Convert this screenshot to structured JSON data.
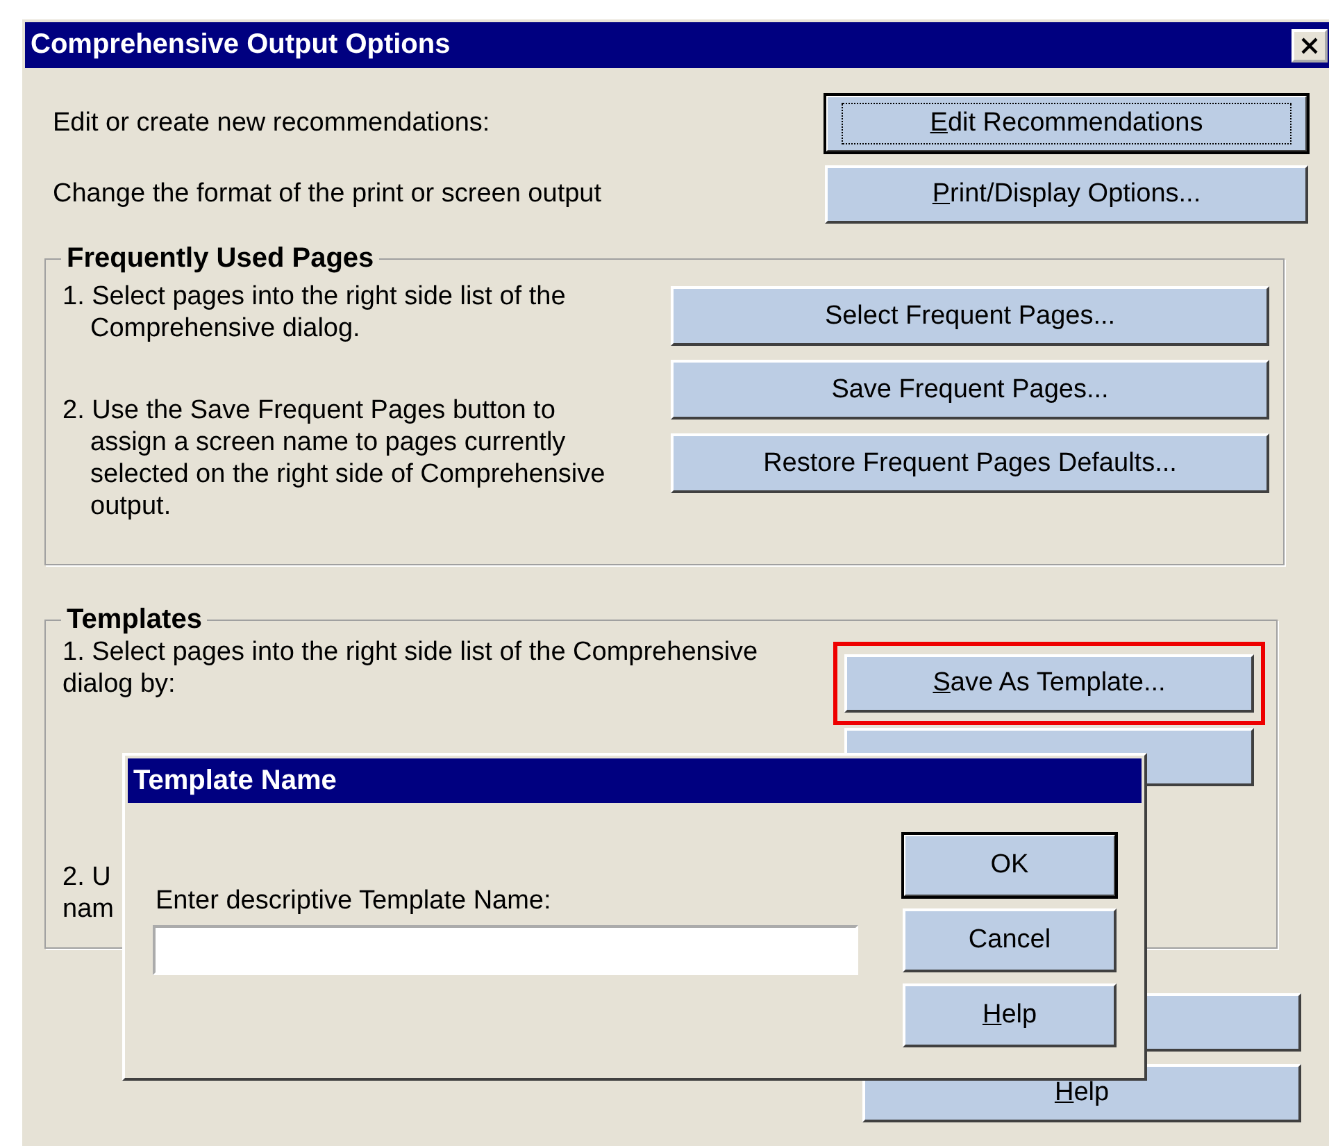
{
  "window": {
    "title": "Comprehensive Output Options"
  },
  "top_rows": [
    {
      "text": "Edit or create new recommendations:",
      "button": {
        "label": "Edit Recommendations",
        "underline_first": true,
        "default": true
      }
    },
    {
      "text": "Change the format of the print or screen output",
      "button": {
        "label": "Print/Display Options...",
        "underline_first": true,
        "default": false
      }
    }
  ],
  "frequent_pages": {
    "title": "Frequently Used Pages",
    "steps": [
      "1. Select pages into the right side list of the Comprehensive dialog.",
      "2. Use the Save Frequent Pages button to assign a screen name to pages currently selected on the right side of Comprehensive output."
    ],
    "buttons": [
      {
        "label": "Select Frequent Pages...",
        "underline_first": false
      },
      {
        "label": "Save Frequent Pages...",
        "underline_first": false
      },
      {
        "label": "Restore Frequent Pages Defaults...",
        "underline_first": false
      }
    ]
  },
  "templates": {
    "title": "Templates",
    "steps": [
      "1. Select pages into the right side list of the Comprehensive dialog by:",
      "2. U",
      "nam"
    ],
    "buttons": [
      {
        "label": "Save As Template...",
        "underline_first": true,
        "highlighted": true
      }
    ]
  },
  "bottom_buttons": [
    {
      "label": "Help",
      "underline_first": true
    }
  ],
  "template_dialog": {
    "title": "Template Name",
    "prompt": "Enter descriptive Template Name:",
    "buttons": [
      {
        "label": "OK",
        "underline_first": false,
        "default": true
      },
      {
        "label": "Cancel",
        "underline_first": false,
        "default": false
      },
      {
        "label": "Help",
        "underline_first": true,
        "default": false
      }
    ]
  }
}
